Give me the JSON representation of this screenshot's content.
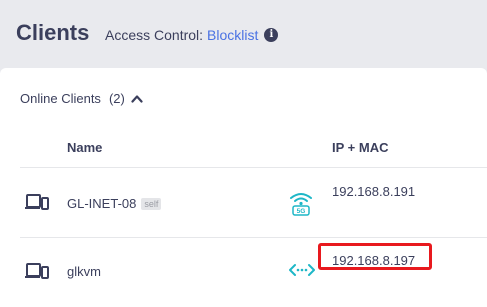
{
  "header": {
    "title": "Clients",
    "access_label": "Access Control:",
    "access_value": "Blocklist",
    "info_icon": "info-icon",
    "info_glyph": "i"
  },
  "online": {
    "label": "Online Clients",
    "count": "(2)",
    "expanded": true
  },
  "columns": {
    "name": "Name",
    "ip_mac": "IP + MAC"
  },
  "clients": [
    {
      "name": "GL-INET-08",
      "badge": "self",
      "connection_icon": "wifi-5g-icon",
      "connection_badge": "5G",
      "ip": "192.168.8.191",
      "device_icon": "computer-device-icon"
    },
    {
      "name": "glkvm",
      "connection_icon": "wired-connection-icon",
      "ip": "192.168.8.197",
      "device_icon": "computer-device-icon",
      "highlighted": true
    }
  ],
  "colors": {
    "text": "#3b3f5c",
    "link": "#4a72e3",
    "accent_teal": "#1eb7c7",
    "highlight": "#e8191e",
    "background": "#e9eaee"
  }
}
